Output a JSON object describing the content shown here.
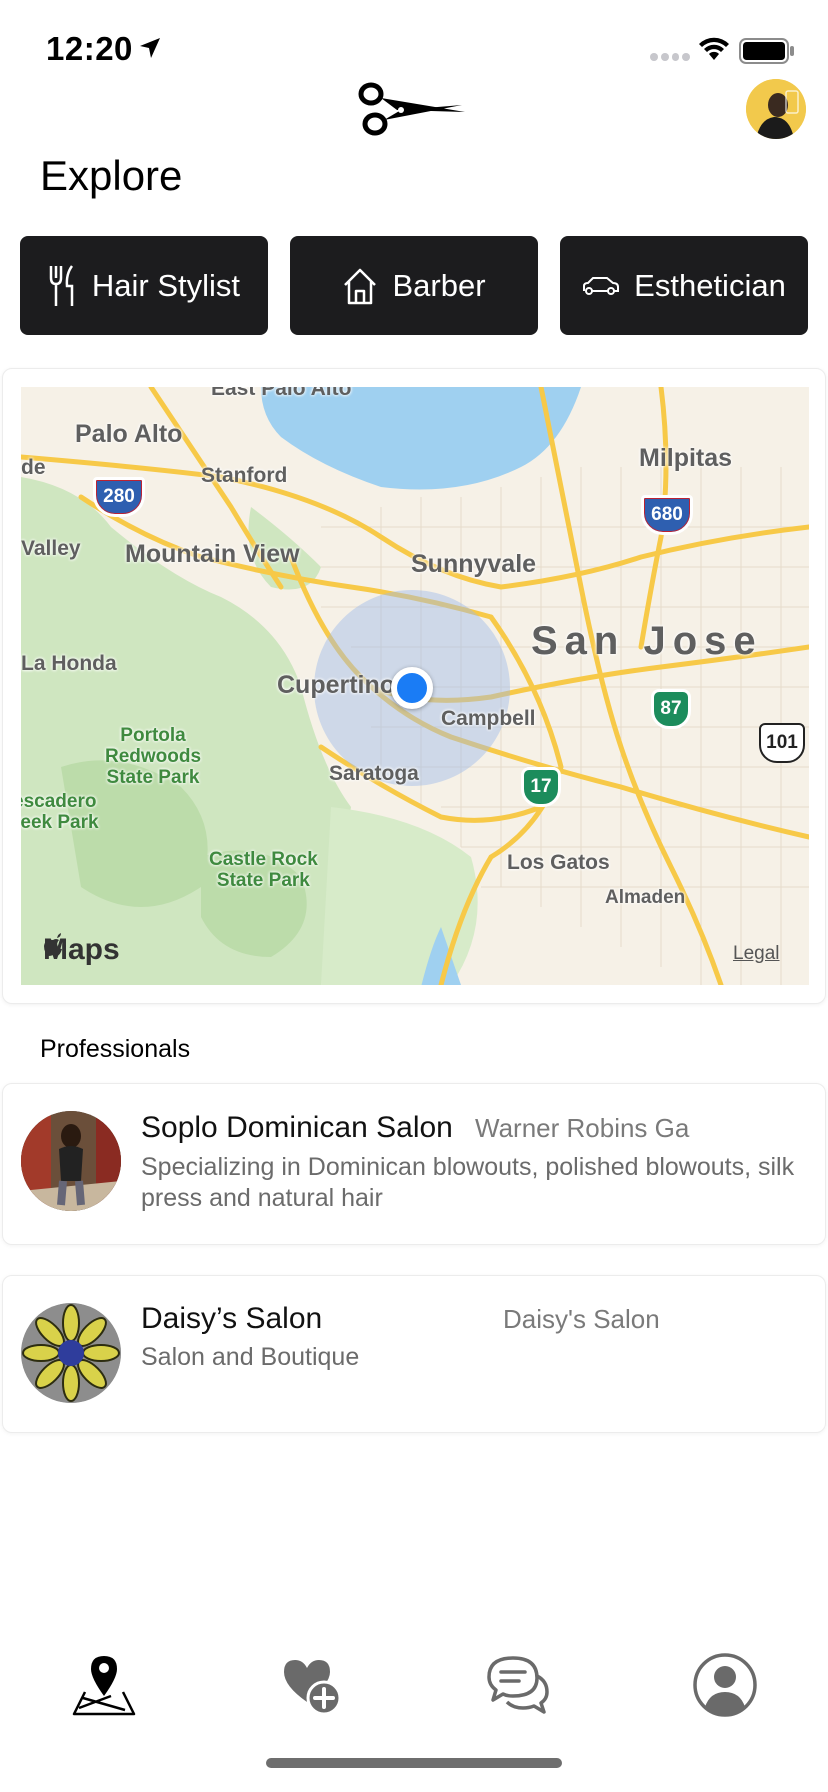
{
  "status_bar": {
    "time": "12:20",
    "icons": [
      "location-arrow-icon",
      "cellular-signal-icon",
      "wifi-icon",
      "battery-icon"
    ]
  },
  "header": {
    "logo_icon": "scissors-icon",
    "avatar": "profile-avatar",
    "title": "Explore"
  },
  "categories": [
    {
      "label": "Hair Stylist",
      "icon": "fork-knife-icon"
    },
    {
      "label": "Barber",
      "icon": "house-icon"
    },
    {
      "label": "Esthetician",
      "icon": "car-icon"
    }
  ],
  "map": {
    "brand": "Maps",
    "legal": "Legal",
    "labels": {
      "east_palo_alto": "East Palo Alto",
      "palo_alto": "Palo Alto",
      "stanford": "Stanford",
      "milpitas": "Milpitas",
      "valley": "Valley",
      "de": "de",
      "mountain_view": "Mountain View",
      "sunnyvale": "Sunnyvale",
      "san_jose": "San Jose",
      "la_honda": "La Honda",
      "cupertino": "Cupertino",
      "campbell": "Campbell",
      "portola": "Portola\nRedwoods\nState Park",
      "saratoga": "Saratoga",
      "escadero": "escadero\nreek Park",
      "castle_rock": "Castle Rock\nState Park",
      "los_gatos": "Los Gatos",
      "almaden": "Almaden"
    },
    "shields": {
      "i280": "280",
      "i680": "680",
      "ca87": "87",
      "us101": "101",
      "ca17": "17"
    }
  },
  "professionals": {
    "section_title": "Professionals",
    "items": [
      {
        "name": "Soplo Dominican Salon",
        "location": "Warner Robins Ga",
        "description": "Specializing in Dominican blowouts, polished blowouts, silk press and natural hair"
      },
      {
        "name": "Daisy’s Salon",
        "location": "Daisy's Salon",
        "description": "Salon and Boutique"
      }
    ]
  },
  "tab_bar": {
    "tabs": [
      "map-pin-icon",
      "heart-plus-icon",
      "chat-bubbles-icon",
      "person-icon"
    ]
  },
  "colors": {
    "button_bg": "#1c1c1e",
    "user_dot": "#1a7cf5",
    "map_road": "#f7c948",
    "map_water": "#9fd0f0",
    "map_park": "#cfe6c0"
  }
}
